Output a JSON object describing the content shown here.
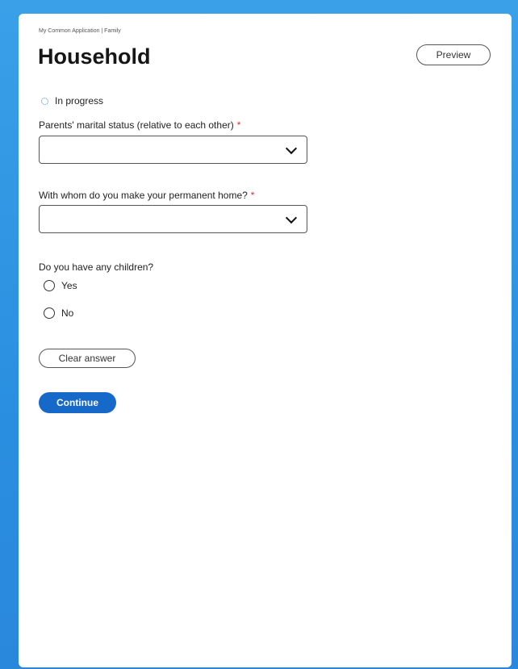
{
  "header": {
    "breadcrumb": "My Common Application | Family",
    "title": "Household",
    "preview_label": "Preview",
    "status_text": "In progress"
  },
  "form": {
    "marital_status": {
      "label": "Parents' marital status (relative to each other)",
      "required_mark": "*",
      "selected_value": ""
    },
    "permanent_home": {
      "label": "With whom do you make your permanent home?",
      "required_mark": "*",
      "selected_value": ""
    },
    "children": {
      "question": "Do you have any children?",
      "options": [
        "Yes",
        "No"
      ],
      "clear_label": "Clear answer"
    },
    "continue_label": "Continue"
  },
  "colors": {
    "accent": "#1769c9",
    "required": "#d32f2f",
    "background": "#2a8fe0"
  },
  "icons": {
    "status": "progress-circle-icon",
    "select": "chevron-down-icon",
    "radio": "radio-unchecked-icon"
  }
}
